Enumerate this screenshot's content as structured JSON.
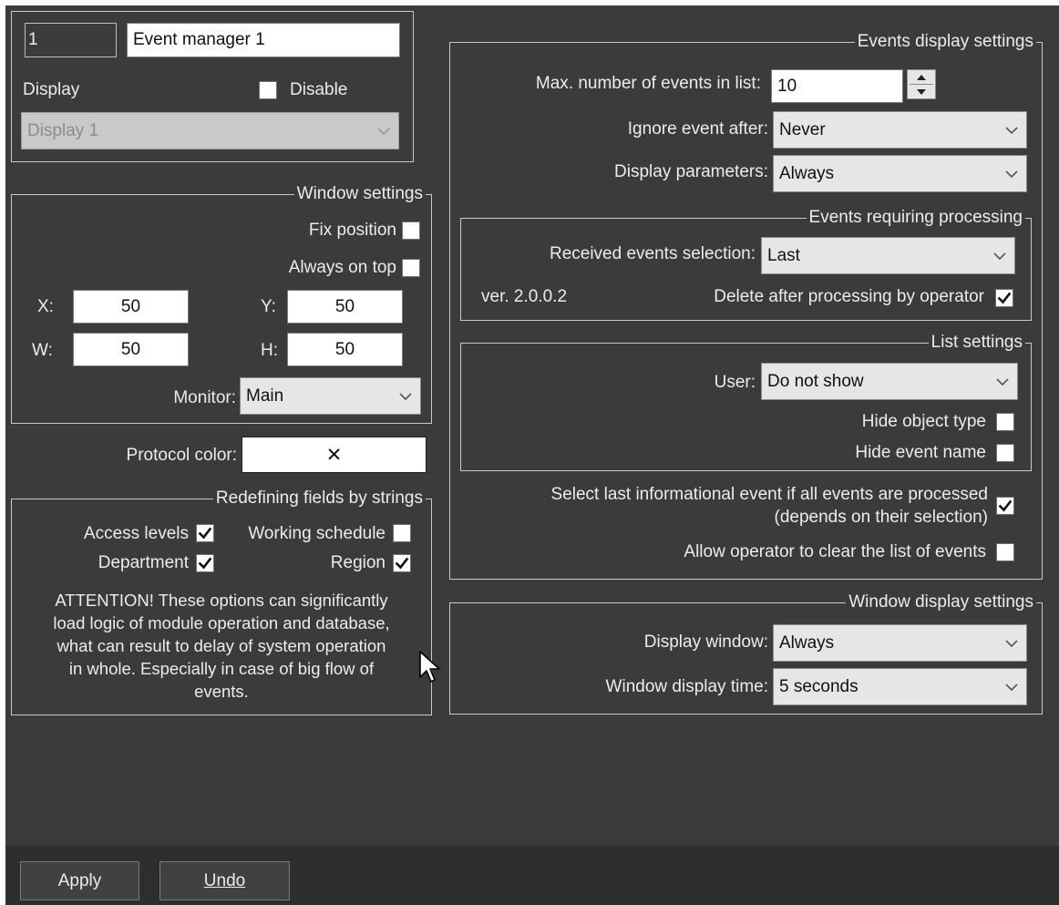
{
  "header": {
    "id_value": "1",
    "name_value": "Event manager 1",
    "display_label": "Display",
    "disable_label": "Disable",
    "disable_checked": false,
    "display_select": "Display 1"
  },
  "window_settings": {
    "title": "Window settings",
    "fix_position_label": "Fix position",
    "fix_position_checked": false,
    "always_on_top_label": "Always on top",
    "always_on_top_checked": false,
    "x_label": "X:",
    "x_value": "50",
    "y_label": "Y:",
    "y_value": "50",
    "w_label": "W:",
    "w_value": "50",
    "h_label": "H:",
    "h_value": "50",
    "monitor_label": "Monitor:",
    "monitor_value": "Main"
  },
  "protocol": {
    "label": "Protocol color:",
    "value": "✕"
  },
  "redefining": {
    "title": "Redefining fields by strings",
    "access_levels_label": "Access levels",
    "access_levels_checked": true,
    "working_schedule_label": "Working schedule",
    "working_schedule_checked": false,
    "department_label": "Department",
    "department_checked": true,
    "region_label": "Region",
    "region_checked": true,
    "attention_lines": [
      "ATTENTION! These options can significantly",
      "load logic of module operation and database,",
      "what can result to delay of system operation",
      "in whole. Especially in case of big flow of",
      "events."
    ]
  },
  "events_display": {
    "title": "Events display settings",
    "max_events_label": "Max. number of events in list:",
    "max_events_value": "10",
    "ignore_after_label": "Ignore event after:",
    "ignore_after_value": "Never",
    "display_params_label": "Display parameters:",
    "display_params_value": "Always"
  },
  "processing": {
    "title": "Events requiring processing",
    "received_label": "Received events selection:",
    "received_value": "Last",
    "version": "ver. 2.0.0.2",
    "delete_label": "Delete after processing by operator",
    "delete_checked": true
  },
  "list_settings": {
    "title": "List settings",
    "user_label": "User:",
    "user_value": "Do not show",
    "hide_object_type_label": "Hide object type",
    "hide_object_type_checked": false,
    "hide_event_name_label": "Hide event name",
    "hide_event_name_checked": false,
    "select_last_line1": "Select last informational event if all events are processed",
    "select_last_line2": "(depends on their selection)",
    "select_last_checked": true,
    "allow_clear_label": "Allow operator to clear the list of events",
    "allow_clear_checked": false
  },
  "window_display": {
    "title": "Window display settings",
    "display_window_label": "Display window:",
    "display_window_value": "Always",
    "display_time_label": "Window display time:",
    "display_time_value": "5 seconds"
  },
  "footer": {
    "apply_label": "Apply",
    "undo_label": "Undo"
  }
}
